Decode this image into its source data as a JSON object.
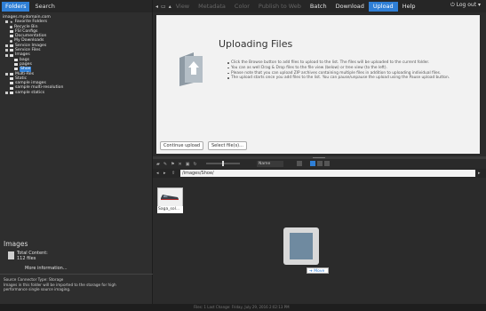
{
  "left_tabs": [
    {
      "label": "Folders",
      "active": true
    },
    {
      "label": "Search",
      "active": false
    }
  ],
  "tree": {
    "root": "images.mydomain.com",
    "items": [
      {
        "label": "Favorite Folders",
        "icon": "star-icon"
      },
      {
        "label": "Recycle Bin",
        "icon": "recycle-icon"
      },
      {
        "label": "FSI Configs",
        "icon": "folder-icon"
      },
      {
        "label": "Documentation",
        "icon": "folder-icon"
      },
      {
        "label": "My Downloads",
        "icon": "download-icon"
      },
      {
        "label": "Service Images",
        "icon": "folder-icon"
      },
      {
        "label": "Service Files",
        "icon": "folder-icon"
      },
      {
        "label": "Images",
        "icon": "folder-icon"
      },
      {
        "label": "bags",
        "icon": "folder-icon"
      },
      {
        "label": "pages",
        "icon": "folder-icon"
      },
      {
        "label": "Shoe",
        "icon": "folder-icon",
        "selected": true
      },
      {
        "label": "Multi-Res",
        "icon": "folder-icon"
      },
      {
        "label": "Static",
        "icon": "folder-icon"
      },
      {
        "label": "sample images",
        "icon": "folder-icon"
      },
      {
        "label": "sample multi-resolution",
        "icon": "folder-icon"
      },
      {
        "label": "sample statics",
        "icon": "folder-icon"
      }
    ]
  },
  "info": {
    "title": "Images",
    "total_label": "Total Content:",
    "total_value": "112 files",
    "more": "More information...",
    "source_line1": "Source Connector Type: Storage",
    "source_line2": "Images in this folder will be imported to the storage for high",
    "source_line3": "performance single source imaging."
  },
  "menu": [
    {
      "label": "View",
      "state": "disabled"
    },
    {
      "label": "Metadata",
      "state": "disabled"
    },
    {
      "label": "Color",
      "state": "disabled"
    },
    {
      "label": "Publish to Web",
      "state": "disabled"
    },
    {
      "label": "Batch",
      "state": "enabled"
    },
    {
      "label": "Download",
      "state": "enabled"
    },
    {
      "label": "Upload",
      "state": "active"
    },
    {
      "label": "Help",
      "state": "enabled"
    }
  ],
  "logout": "Log out",
  "upload": {
    "title": "Uploading Files",
    "bullets": [
      "Click the Browse button to add files to upload to the list. The files will be uploaded to the current folder.",
      "You can as well Drag & Drop files to the file view (below) or tree view (to the left).",
      "Please note that you can upload ZIP archives containing multiple files in addition to uploading individual files.",
      "The upload starts once you add files to the list. You can pause/unpause the upload using the Pause upload button."
    ],
    "continue_btn": "Continue upload",
    "select_btn": "Select file(s)..."
  },
  "toolbar": {
    "sort_value": "Name"
  },
  "path": "/images/Shoe/",
  "files": [
    {
      "label": "Saga_sol..."
    }
  ],
  "drag": {
    "tip": "Move"
  },
  "status": {
    "text": "Files: 1     Last Change: Friday, July 29, 2016 2:02:13 PM"
  },
  "colors": {
    "accent": "#2f7fd6",
    "panel": "#2b2b2b",
    "upload_bg": "#f2f2f2"
  }
}
